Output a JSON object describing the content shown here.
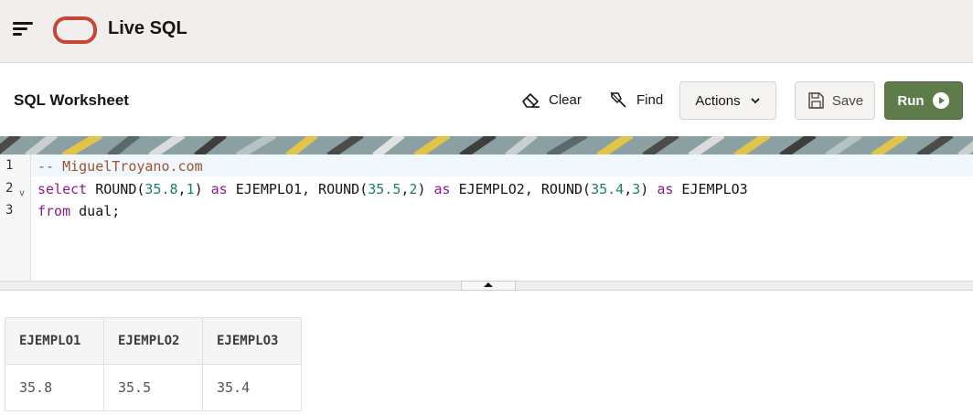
{
  "app": {
    "title": "Live SQL"
  },
  "toolbar": {
    "title": "SQL Worksheet",
    "clear_label": "Clear",
    "find_label": "Find",
    "actions_label": "Actions",
    "save_label": "Save",
    "run_label": "Run"
  },
  "editor": {
    "line_numbers": [
      "1",
      "2",
      "3"
    ],
    "fold_marker": "v",
    "lines": [
      [
        {
          "t": "-- MiguelTroyano.com",
          "c": "comment"
        }
      ],
      [
        {
          "t": "select",
          "c": "kw"
        },
        {
          "t": " ROUND(",
          "c": ""
        },
        {
          "t": "35.8",
          "c": "num"
        },
        {
          "t": ",",
          "c": ""
        },
        {
          "t": "1",
          "c": "num"
        },
        {
          "t": ") ",
          "c": ""
        },
        {
          "t": "as",
          "c": "kw"
        },
        {
          "t": " EJEMPLO1, ROUND(",
          "c": ""
        },
        {
          "t": "35.5",
          "c": "num"
        },
        {
          "t": ",",
          "c": ""
        },
        {
          "t": "2",
          "c": "num"
        },
        {
          "t": ") ",
          "c": ""
        },
        {
          "t": "as",
          "c": "kw"
        },
        {
          "t": " EJEMPLO2, ROUND(",
          "c": ""
        },
        {
          "t": "35.4",
          "c": "num"
        },
        {
          "t": ",",
          "c": ""
        },
        {
          "t": "3",
          "c": "num"
        },
        {
          "t": ") ",
          "c": ""
        },
        {
          "t": "as",
          "c": "kw"
        },
        {
          "t": " EJEMPLO3",
          "c": ""
        }
      ],
      [
        {
          "t": "from",
          "c": "kw"
        },
        {
          "t": " dual;",
          "c": ""
        }
      ]
    ]
  },
  "results": {
    "columns": [
      "EJEMPLO1",
      "EJEMPLO2",
      "EJEMPLO3"
    ],
    "rows": [
      [
        "35.8",
        "35.5",
        "35.4"
      ]
    ]
  },
  "icons": {
    "menu": "hamburger-icon",
    "logo": "oracle-logo",
    "clear": "eraser-icon",
    "find": "flashlight-icon",
    "actions": "chevron-down-icon",
    "save": "floppy-disk-icon",
    "run": "play-circle-icon"
  },
  "colors": {
    "run_button": "#5e7b4a",
    "logo": "#c74634",
    "topbar": "#f1efed"
  }
}
